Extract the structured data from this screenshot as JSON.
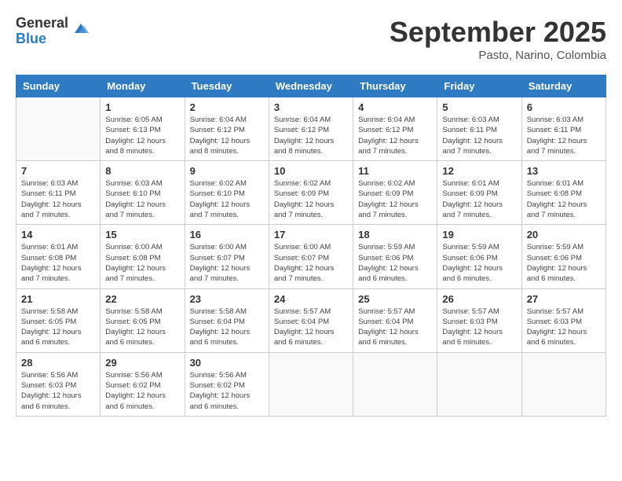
{
  "header": {
    "logo_general": "General",
    "logo_blue": "Blue",
    "month_title": "September 2025",
    "subtitle": "Pasto, Narino, Colombia"
  },
  "days_of_week": [
    "Sunday",
    "Monday",
    "Tuesday",
    "Wednesday",
    "Thursday",
    "Friday",
    "Saturday"
  ],
  "weeks": [
    [
      {
        "day": "",
        "info": ""
      },
      {
        "day": "1",
        "info": "Sunrise: 6:05 AM\nSunset: 6:13 PM\nDaylight: 12 hours\nand 8 minutes."
      },
      {
        "day": "2",
        "info": "Sunrise: 6:04 AM\nSunset: 6:12 PM\nDaylight: 12 hours\nand 8 minutes."
      },
      {
        "day": "3",
        "info": "Sunrise: 6:04 AM\nSunset: 6:12 PM\nDaylight: 12 hours\nand 8 minutes."
      },
      {
        "day": "4",
        "info": "Sunrise: 6:04 AM\nSunset: 6:12 PM\nDaylight: 12 hours\nand 7 minutes."
      },
      {
        "day": "5",
        "info": "Sunrise: 6:03 AM\nSunset: 6:11 PM\nDaylight: 12 hours\nand 7 minutes."
      },
      {
        "day": "6",
        "info": "Sunrise: 6:03 AM\nSunset: 6:11 PM\nDaylight: 12 hours\nand 7 minutes."
      }
    ],
    [
      {
        "day": "7",
        "info": "Sunrise: 6:03 AM\nSunset: 6:11 PM\nDaylight: 12 hours\nand 7 minutes."
      },
      {
        "day": "8",
        "info": "Sunrise: 6:03 AM\nSunset: 6:10 PM\nDaylight: 12 hours\nand 7 minutes."
      },
      {
        "day": "9",
        "info": "Sunrise: 6:02 AM\nSunset: 6:10 PM\nDaylight: 12 hours\nand 7 minutes."
      },
      {
        "day": "10",
        "info": "Sunrise: 6:02 AM\nSunset: 6:09 PM\nDaylight: 12 hours\nand 7 minutes."
      },
      {
        "day": "11",
        "info": "Sunrise: 6:02 AM\nSunset: 6:09 PM\nDaylight: 12 hours\nand 7 minutes."
      },
      {
        "day": "12",
        "info": "Sunrise: 6:01 AM\nSunset: 6:09 PM\nDaylight: 12 hours\nand 7 minutes."
      },
      {
        "day": "13",
        "info": "Sunrise: 6:01 AM\nSunset: 6:08 PM\nDaylight: 12 hours\nand 7 minutes."
      }
    ],
    [
      {
        "day": "14",
        "info": "Sunrise: 6:01 AM\nSunset: 6:08 PM\nDaylight: 12 hours\nand 7 minutes."
      },
      {
        "day": "15",
        "info": "Sunrise: 6:00 AM\nSunset: 6:08 PM\nDaylight: 12 hours\nand 7 minutes."
      },
      {
        "day": "16",
        "info": "Sunrise: 6:00 AM\nSunset: 6:07 PM\nDaylight: 12 hours\nand 7 minutes."
      },
      {
        "day": "17",
        "info": "Sunrise: 6:00 AM\nSunset: 6:07 PM\nDaylight: 12 hours\nand 7 minutes."
      },
      {
        "day": "18",
        "info": "Sunrise: 5:59 AM\nSunset: 6:06 PM\nDaylight: 12 hours\nand 6 minutes."
      },
      {
        "day": "19",
        "info": "Sunrise: 5:59 AM\nSunset: 6:06 PM\nDaylight: 12 hours\nand 6 minutes."
      },
      {
        "day": "20",
        "info": "Sunrise: 5:59 AM\nSunset: 6:06 PM\nDaylight: 12 hours\nand 6 minutes."
      }
    ],
    [
      {
        "day": "21",
        "info": "Sunrise: 5:58 AM\nSunset: 6:05 PM\nDaylight: 12 hours\nand 6 minutes."
      },
      {
        "day": "22",
        "info": "Sunrise: 5:58 AM\nSunset: 6:05 PM\nDaylight: 12 hours\nand 6 minutes."
      },
      {
        "day": "23",
        "info": "Sunrise: 5:58 AM\nSunset: 6:04 PM\nDaylight: 12 hours\nand 6 minutes."
      },
      {
        "day": "24",
        "info": "Sunrise: 5:57 AM\nSunset: 6:04 PM\nDaylight: 12 hours\nand 6 minutes."
      },
      {
        "day": "25",
        "info": "Sunrise: 5:57 AM\nSunset: 6:04 PM\nDaylight: 12 hours\nand 6 minutes."
      },
      {
        "day": "26",
        "info": "Sunrise: 5:57 AM\nSunset: 6:03 PM\nDaylight: 12 hours\nand 6 minutes."
      },
      {
        "day": "27",
        "info": "Sunrise: 5:57 AM\nSunset: 6:03 PM\nDaylight: 12 hours\nand 6 minutes."
      }
    ],
    [
      {
        "day": "28",
        "info": "Sunrise: 5:56 AM\nSunset: 6:03 PM\nDaylight: 12 hours\nand 6 minutes."
      },
      {
        "day": "29",
        "info": "Sunrise: 5:56 AM\nSunset: 6:02 PM\nDaylight: 12 hours\nand 6 minutes."
      },
      {
        "day": "30",
        "info": "Sunrise: 5:56 AM\nSunset: 6:02 PM\nDaylight: 12 hours\nand 6 minutes."
      },
      {
        "day": "",
        "info": ""
      },
      {
        "day": "",
        "info": ""
      },
      {
        "day": "",
        "info": ""
      },
      {
        "day": "",
        "info": ""
      }
    ]
  ]
}
